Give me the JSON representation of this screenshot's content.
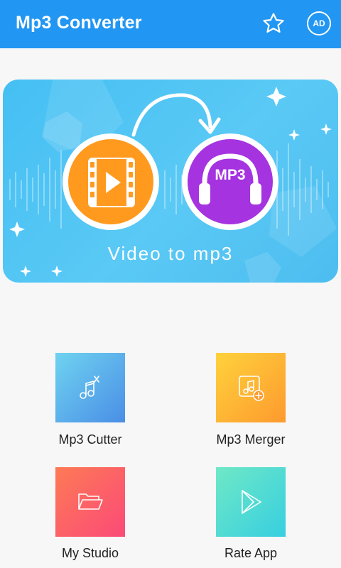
{
  "appbar": {
    "title": "Mp3 Converter",
    "favorite_icon": "star-outline-icon",
    "ad_badge": "AD"
  },
  "banner": {
    "caption": "Video to mp3",
    "source_icon": "video-film-icon",
    "target_icon": "headphones-mp3-icon",
    "target_badge_text": "MP3"
  },
  "tools": [
    {
      "label": "Mp3 Cutter",
      "icon": "music-note-scissors-icon",
      "color_start": "#6fd3f0",
      "color_end": "#4a8ee6"
    },
    {
      "label": "Mp3 Merger",
      "icon": "music-note-add-icon",
      "color_start": "#ffd23c",
      "color_end": "#fd9a2e"
    },
    {
      "label": "My Studio",
      "icon": "folder-open-icon",
      "color_start": "#fd7a55",
      "color_end": "#fb4a78"
    },
    {
      "label": "Rate App",
      "icon": "play-store-icon",
      "color_start": "#6fe8c6",
      "color_end": "#37cfe0"
    }
  ],
  "colors": {
    "appbar": "#2196f3",
    "background": "#f7f7f7"
  }
}
